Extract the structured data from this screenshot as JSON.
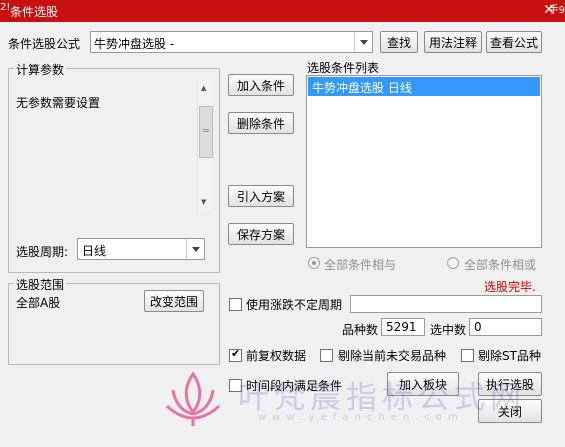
{
  "window": {
    "title": "条件选股",
    "corner_left": "2!",
    "corner_right": "手9"
  },
  "formula": {
    "label": "条件选股公式",
    "value": "牛势冲盘选股  -"
  },
  "buttons": {
    "find": "查找",
    "usage": "用法注释",
    "view_formula": "查看公式",
    "add_condition": "加入条件",
    "delete_condition": "删除条件",
    "import_plan": "引入方案",
    "save_plan": "保存方案",
    "change_range": "改变范围",
    "add_to_board": "加入板块",
    "execute": "执行选股",
    "close": "关闭"
  },
  "params": {
    "legend": "计算参数",
    "message": "无参数需要设置"
  },
  "period": {
    "label": "选股周期:",
    "value": "日线"
  },
  "conditions": {
    "label": "选股条件列表",
    "items": [
      "牛势冲盘选股  日线"
    ]
  },
  "logic": {
    "all_and": "全部条件相与",
    "all_or": "全部条件相或"
  },
  "status": {
    "text": "选股完毕.",
    "color": "#d00000"
  },
  "range": {
    "legend": "选股范围",
    "value": "全部A股"
  },
  "options": {
    "uncertain_period": "使用涨跌不定周期",
    "pre_adjust": "前复权数据",
    "exclude_untraded": "剔除当前未交易品种",
    "exclude_st": "剔除ST品种",
    "time_range": "时间段内满足条件"
  },
  "counts": {
    "varieties_label": "品种数",
    "varieties_value": "5291",
    "selected_label": "选中数",
    "selected_value": "0"
  },
  "watermark": {
    "text": "叶梵晨指标公式网",
    "url": "www.yefanchen.com"
  }
}
